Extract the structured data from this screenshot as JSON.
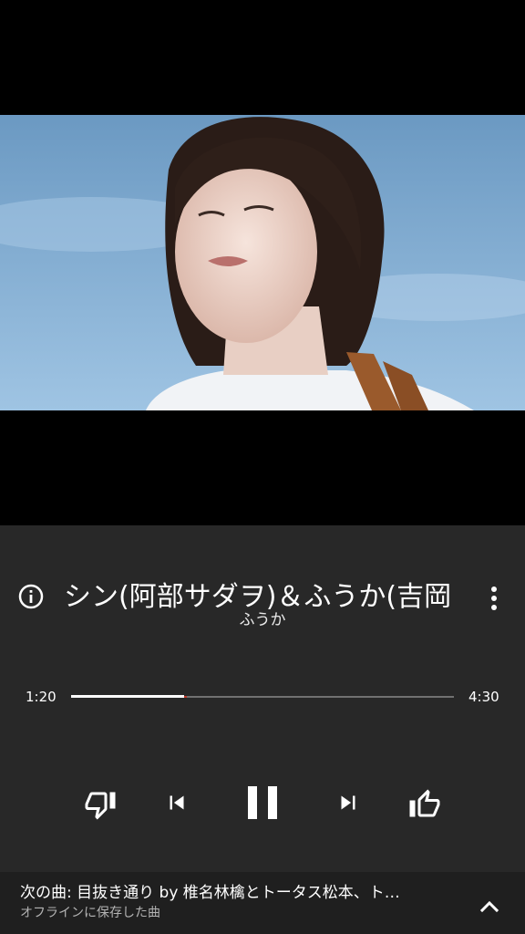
{
  "video": {
    "description_icon": "video-thumbnail"
  },
  "track": {
    "title": "シン(阿部サダヲ)＆ふうか(吉岡",
    "artist": "ふうか"
  },
  "progress": {
    "current": "1:20",
    "duration": "4:30",
    "fraction": 0.296
  },
  "controls": {
    "icons": [
      "info-icon",
      "more-vert-icon",
      "thumbs-down-icon",
      "skip-previous-icon",
      "pause-icon",
      "skip-next-icon",
      "thumbs-up-icon",
      "chevron-up-icon"
    ]
  },
  "up_next": {
    "title": "次の曲: 目抜き通り by 椎名林檎とトータス松本、ト…",
    "subtitle": "オフラインに保存した曲"
  },
  "colors": {
    "player_bg": "#282828",
    "bottom_bar_bg": "#1f1f1f",
    "progress_fill": "#ffffff",
    "progress_track": "#717171"
  }
}
